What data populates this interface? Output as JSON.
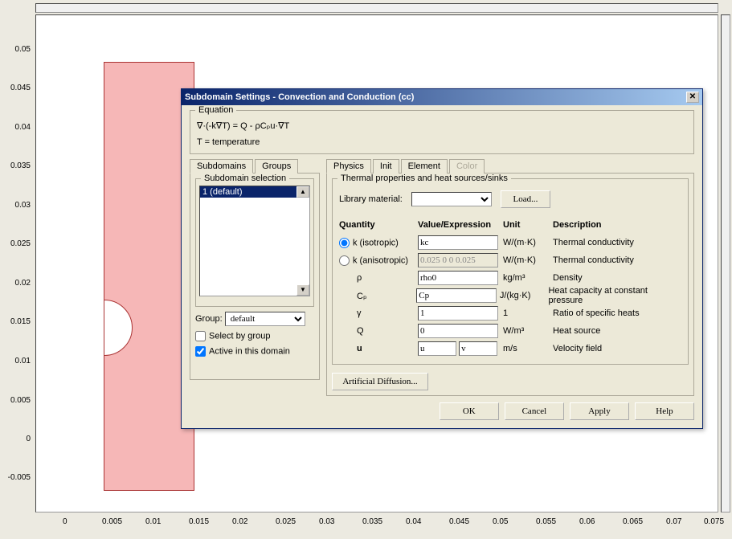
{
  "axis": {
    "y": [
      "0.05",
      "0.045",
      "0.04",
      "0.035",
      "0.03",
      "0.025",
      "0.02",
      "0.015",
      "0.01",
      "0.005",
      "0",
      "-0.005"
    ],
    "x": [
      "0",
      "0.005",
      "0.01",
      "0.015",
      "0.02",
      "0.025",
      "0.03",
      "0.035",
      "0.04",
      "0.045",
      "0.05",
      "0.055",
      "0.06",
      "0.065",
      "0.07",
      "0.075"
    ]
  },
  "dialog": {
    "title": "Subdomain Settings - Convection and Conduction (cc)",
    "equation": {
      "legend": "Equation",
      "line1": "∇·(-k∇T) = Q - ρCₚu·∇T",
      "line2": "T = temperature"
    },
    "left": {
      "tab_subdomains": "Subdomains",
      "tab_groups": "Groups",
      "selection_legend": "Subdomain selection",
      "list_item": "1 (default)",
      "group_label": "Group:",
      "group_value": "default",
      "chk_selectgroup": "Select by group",
      "chk_active": "Active in this domain"
    },
    "right": {
      "tab_physics": "Physics",
      "tab_init": "Init",
      "tab_element": "Element",
      "tab_color": "Color",
      "panel_legend": "Thermal properties and heat sources/sinks",
      "lib_label": "Library material:",
      "lib_value": "",
      "btn_load": "Load...",
      "hdr_quantity": "Quantity",
      "hdr_value": "Value/Expression",
      "hdr_unit": "Unit",
      "hdr_desc": "Description",
      "rows": {
        "kiso": {
          "q": "k (isotropic)",
          "v": "kc",
          "u": "W/(m·K)",
          "d": "Thermal conductivity"
        },
        "kani": {
          "q": "k (anisotropic)",
          "v": "0.025 0 0 0.025",
          "u": "W/(m·K)",
          "d": "Thermal conductivity"
        },
        "rho": {
          "q": "ρ",
          "v": "rho0",
          "u": "kg/m³",
          "d": "Density"
        },
        "cp": {
          "q": "Cₚ",
          "v": "Cp",
          "u": "J/(kg·K)",
          "d": "Heat capacity at constant pressure"
        },
        "gamma": {
          "q": "γ",
          "v": "1",
          "u": "1",
          "d": "Ratio of specific heats"
        },
        "Q": {
          "q": "Q",
          "v": "0",
          "u": "W/m³",
          "d": "Heat source"
        },
        "u": {
          "q": "u",
          "v1": "u",
          "v2": "v",
          "u_": "m/s",
          "d": "Velocity field"
        }
      },
      "btn_artdiff": "Artificial Diffusion..."
    },
    "buttons": {
      "ok": "OK",
      "cancel": "Cancel",
      "apply": "Apply",
      "help": "Help"
    }
  },
  "chart_data": {
    "type": "area",
    "title": "",
    "xlabel": "",
    "ylabel": "",
    "xlim": [
      0,
      0.075
    ],
    "ylim": [
      -0.005,
      0.05
    ],
    "description": "Pink rectangular domain spanning x=[0,0.01], y=[-0.005,0.05] with a semicircular cutout on the left edge centered near y=0.015, radius ≈ 0.0035."
  }
}
